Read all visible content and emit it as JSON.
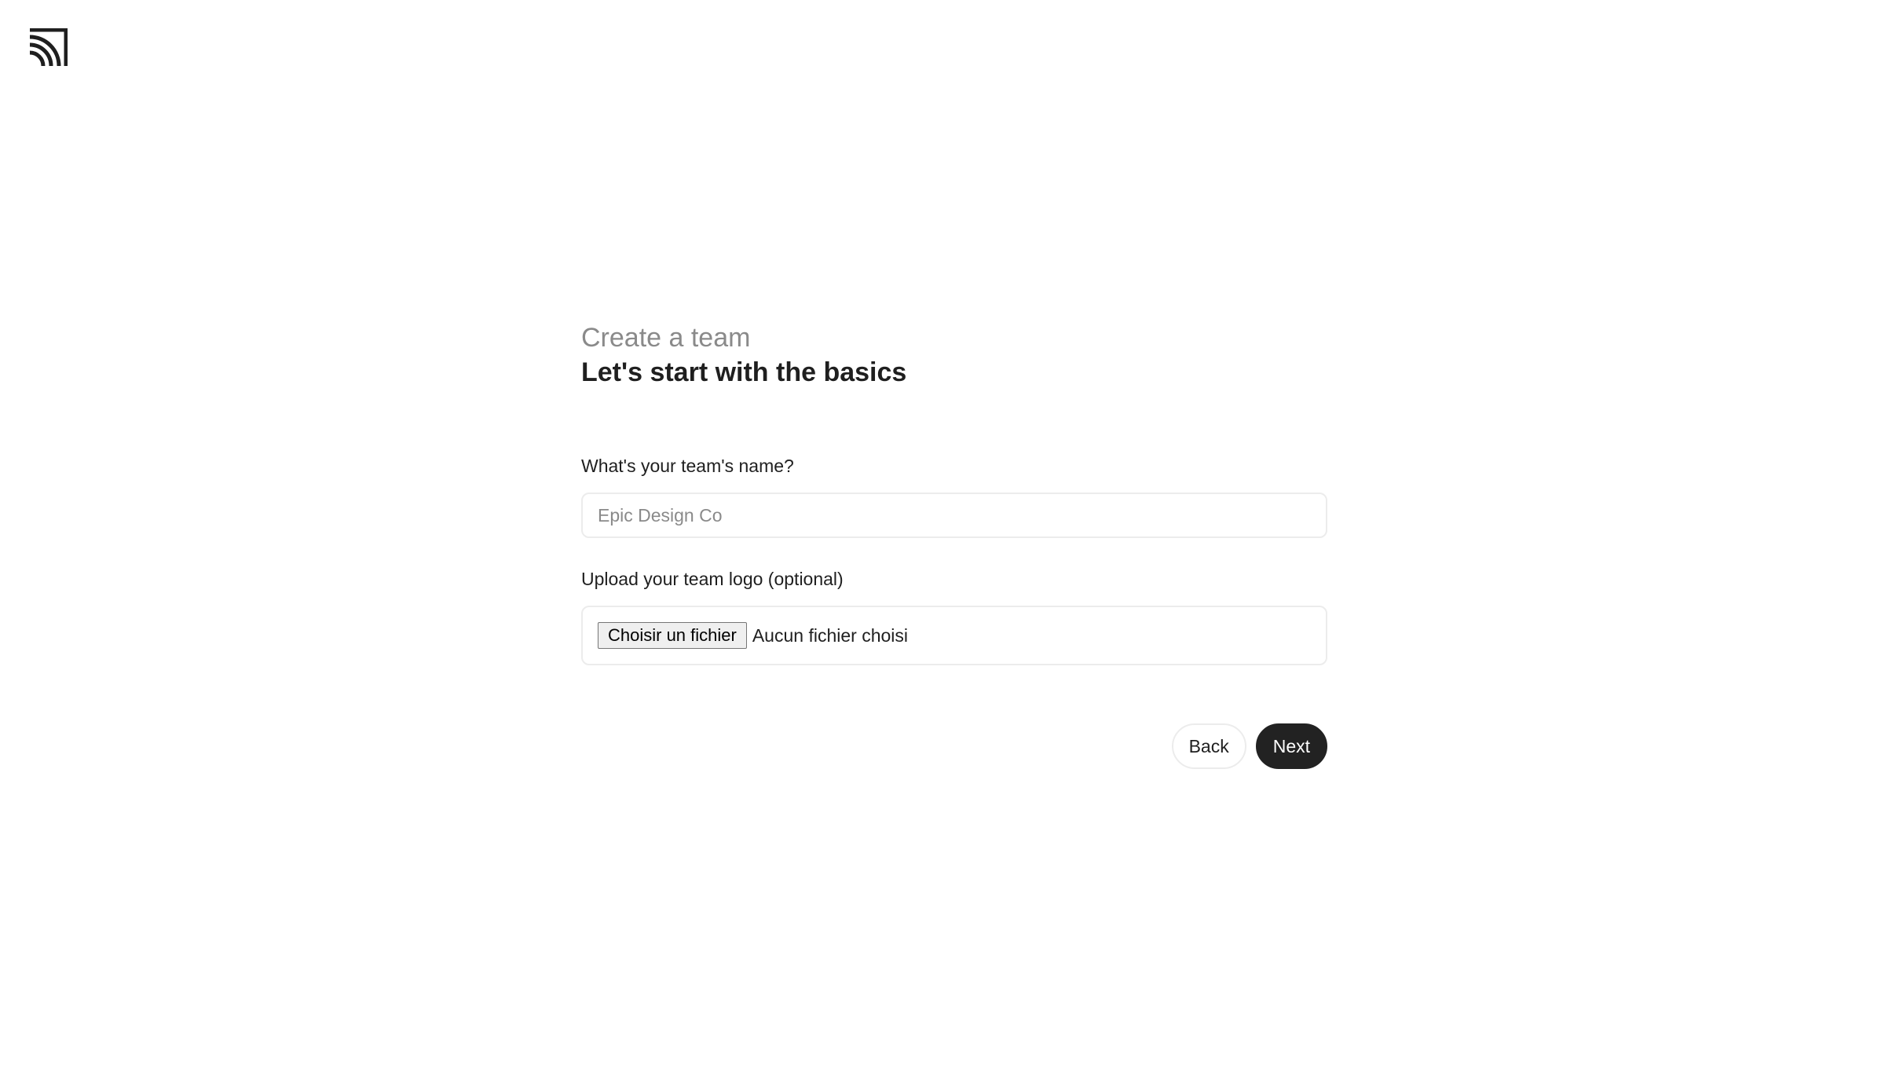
{
  "header": {
    "logo_icon": "brand-arcs-logo-icon"
  },
  "form": {
    "subtitle": "Create a team",
    "title": "Let's start with the basics",
    "team_name": {
      "label": "What's your team's name?",
      "placeholder": "Epic Design Co",
      "value": ""
    },
    "team_logo": {
      "label": "Upload your team logo (optional)",
      "button_label": "Choisir un fichier",
      "status": "Aucun fichier choisi"
    }
  },
  "actions": {
    "back_label": "Back",
    "next_label": "Next"
  },
  "colors": {
    "primary_button": "#222222",
    "muted_text": "#8a8a8a",
    "border": "#ececec"
  }
}
